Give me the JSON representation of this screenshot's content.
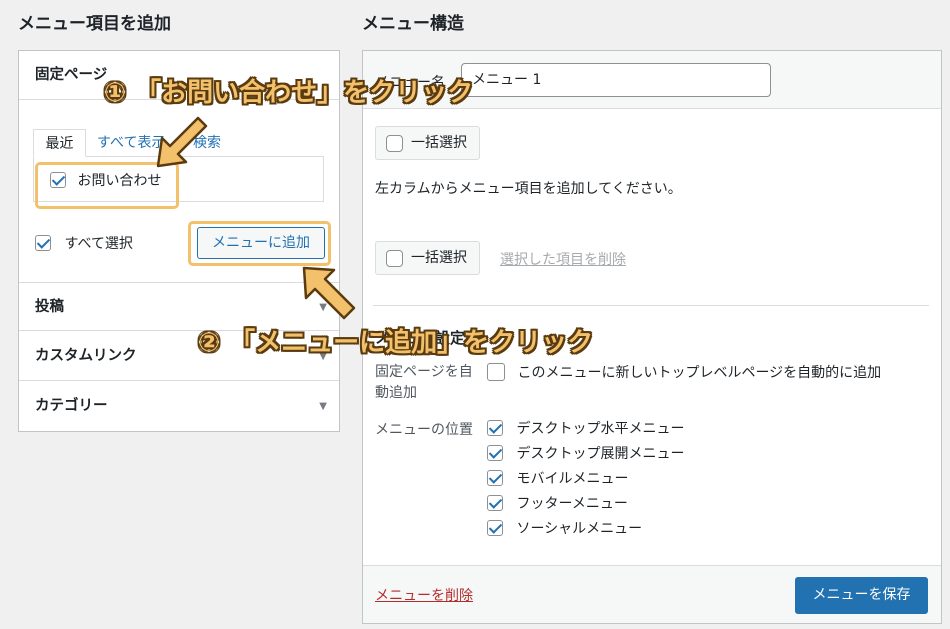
{
  "left": {
    "title": "メニュー項目を追加",
    "pages_section": "固定ページ",
    "tabs": [
      "最近",
      "すべて表示",
      "検索"
    ],
    "item_label": "お問い合わせ",
    "item_checked": true,
    "select_all_label": "すべて選択",
    "add_button": "メニューに追加",
    "sections": [
      "投稿",
      "カスタムリンク",
      "カテゴリー"
    ]
  },
  "right": {
    "title": "メニュー構造",
    "menu_name_label": "メニュー名",
    "menu_name_value": "メニュー 1",
    "bulk_select": "一括選択",
    "empty_hint": "左カラムからメニュー項目を追加してください。",
    "delete_selected": "選択した項目を削除",
    "settings_heading": "メニュー設定",
    "auto_add_label": "固定ページを自動追加",
    "auto_add_option": "このメニューに新しいトップレベルページを自動的に追加",
    "position_label": "メニューの位置",
    "positions": [
      {
        "label": "デスクトップ水平メニュー",
        "checked": true
      },
      {
        "label": "デスクトップ展開メニュー",
        "checked": true
      },
      {
        "label": "モバイルメニュー",
        "checked": true
      },
      {
        "label": "フッターメニュー",
        "checked": true
      },
      {
        "label": "ソーシャルメニュー",
        "checked": true
      }
    ],
    "delete_menu": "メニューを削除",
    "save_menu": "メニューを保存"
  },
  "annotations": {
    "step1": "① 「お問い合わせ」をクリック",
    "step2": "② 「メニューに追加」をクリック",
    "color": "#f3c06b"
  },
  "colors": {
    "primary": "#2271b1",
    "danger": "#b32d2e"
  }
}
